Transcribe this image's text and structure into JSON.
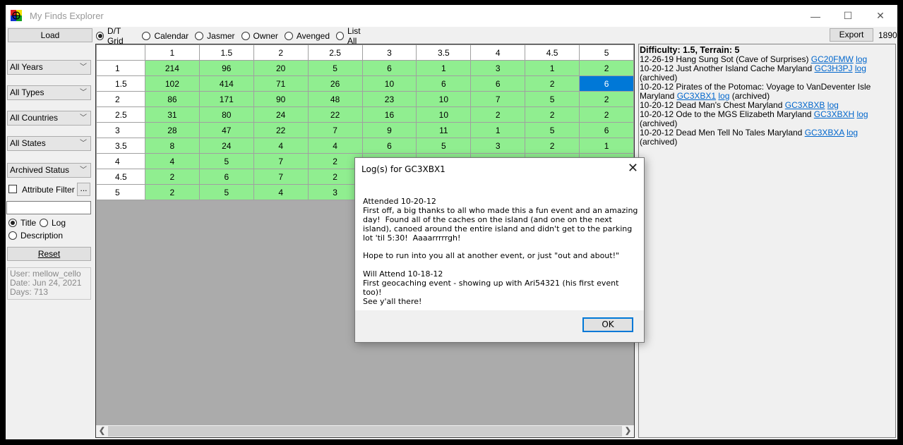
{
  "window": {
    "title": "My Finds Explorer",
    "icon": "geocache-logo-icon",
    "controls": {
      "minimize": "—",
      "maximize": "☐",
      "close": "✕"
    }
  },
  "toolbar": {
    "load_label": "Load",
    "export_label": "Export",
    "count": "1890",
    "views": [
      {
        "label": "D/T Grid",
        "selected": true
      },
      {
        "label": "Calendar",
        "selected": false
      },
      {
        "label": "Jasmer",
        "selected": false
      },
      {
        "label": "Owner",
        "selected": false
      },
      {
        "label": "Avenged",
        "selected": false
      },
      {
        "label": "List All",
        "selected": false
      }
    ]
  },
  "sidebar": {
    "filters": [
      "All Years",
      "All Types",
      "All Countries",
      "All States",
      "Archived Status"
    ],
    "attribute_filter_label": "Attribute Filter",
    "attribute_filter_checked": false,
    "attribute_button_label": "...",
    "search_value": "",
    "search_modes": [
      {
        "label": "Title",
        "selected": true
      },
      {
        "label": "Log",
        "selected": false
      },
      {
        "label": "Description",
        "selected": false
      }
    ],
    "reset_label": "Reset",
    "info": {
      "user": "User: mellow_cello",
      "date": "Date: Jun 24, 2021",
      "days": "Days: 713"
    }
  },
  "grid": {
    "columns": [
      "1",
      "1.5",
      "2",
      "2.5",
      "3",
      "3.5",
      "4",
      "4.5",
      "5"
    ],
    "rows": [
      {
        "label": "1",
        "values": [
          "214",
          "96",
          "20",
          "5",
          "6",
          "1",
          "3",
          "1",
          "2"
        ]
      },
      {
        "label": "1.5",
        "values": [
          "102",
          "414",
          "71",
          "26",
          "10",
          "6",
          "6",
          "2",
          "6"
        ]
      },
      {
        "label": "2",
        "values": [
          "86",
          "171",
          "90",
          "48",
          "23",
          "10",
          "7",
          "5",
          "2"
        ]
      },
      {
        "label": "2.5",
        "values": [
          "31",
          "80",
          "24",
          "22",
          "16",
          "10",
          "2",
          "2",
          "2"
        ]
      },
      {
        "label": "3",
        "values": [
          "28",
          "47",
          "22",
          "7",
          "9",
          "11",
          "1",
          "5",
          "6"
        ]
      },
      {
        "label": "3.5",
        "values": [
          "8",
          "24",
          "4",
          "4",
          "6",
          "5",
          "3",
          "2",
          "1"
        ]
      },
      {
        "label": "4",
        "values": [
          "4",
          "5",
          "7",
          "2",
          "",
          "",
          "",
          "",
          ""
        ]
      },
      {
        "label": "4.5",
        "values": [
          "2",
          "6",
          "7",
          "2",
          "",
          "",
          "",
          "",
          ""
        ]
      },
      {
        "label": "5",
        "values": [
          "2",
          "5",
          "4",
          "3",
          "",
          "",
          "",
          "",
          ""
        ]
      }
    ],
    "selected": {
      "row": 1,
      "col": 8
    },
    "cell_color": "#90ee90",
    "selected_color": "#0078d7"
  },
  "details": {
    "heading": "Difficulty: 1.5, Terrain: 5",
    "entries": [
      {
        "text": "12-26-19 Hang Sung Sot (Cave of Surprises) ",
        "code": "GC20FMW",
        "log": "log",
        "suffix": ""
      },
      {
        "text": "10-20-12 Just Another Island Cache Maryland ",
        "code": "GC3H3PJ",
        "log": "log",
        "suffix": " (archived)"
      },
      {
        "text": "10-20-12 Pirates of the Potomac: Voyage to VanDeventer Isle Maryland ",
        "code": "GC3XBX1",
        "log": "log",
        "suffix": " (archived)"
      },
      {
        "text": "10-20-12 Dead Man's Chest Maryland ",
        "code": "GC3XBXB",
        "log": "log",
        "suffix": ""
      },
      {
        "text": "10-20-12 Ode to the MGS Elizabeth Maryland ",
        "code": "GC3XBXH",
        "log": "log",
        "suffix": " (archived)"
      },
      {
        "text": "10-20-12 Dead Men Tell No Tales Maryland ",
        "code": "GC3XBXA",
        "log": "log",
        "suffix": " (archived)"
      }
    ]
  },
  "dialog": {
    "title": "Log(s) for GC3XBX1",
    "body": "Attended 10-20-12\nFirst off, a big thanks to all who made this a fun event and an amazing day!  Found all of the caches on the island (and one on the next island), canoed around the entire island and didn't get to the parking lot 'til 5:30!  Aaaarrrrrgh!\n\nHope to run into you all at another event, or just \"out and about!\"\n\nWill Attend 10-18-12\nFirst geocaching event - showing up with Ari54321 (his first event too)!\nSee y'all there!",
    "ok_label": "OK",
    "close": "✕"
  },
  "scrollbar": {
    "left": "❮",
    "right": "❯"
  }
}
